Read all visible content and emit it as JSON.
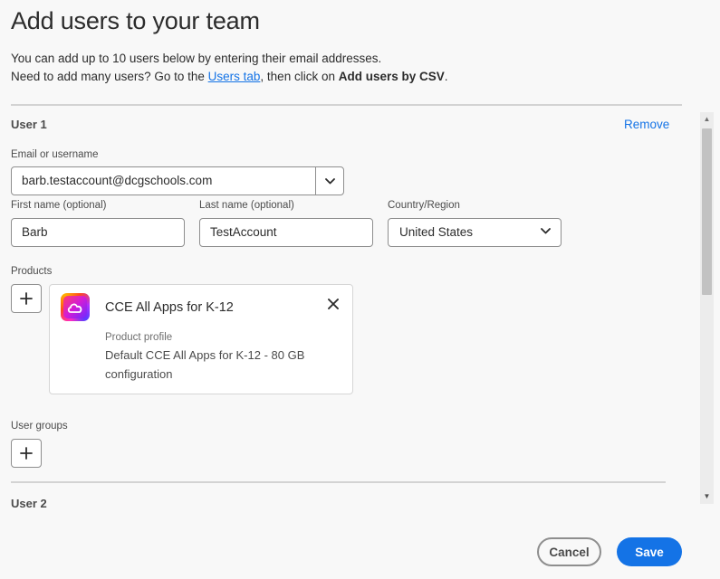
{
  "dialog": {
    "title": "Add users to your team",
    "intro_line1": "You can add up to 10 users below by entering their email addresses.",
    "intro_line2_pre": "Need to add many users? Go to the ",
    "intro_link": "Users tab",
    "intro_line2_mid": ", then click on ",
    "intro_bold": "Add users by CSV",
    "intro_line2_end": "."
  },
  "user1": {
    "heading": "User 1",
    "remove_label": "Remove",
    "email_label": "Email or username",
    "email_value": "barb.testaccount@dcgschools.com",
    "first_name_label": "First name (optional)",
    "first_name_value": "Barb",
    "last_name_label": "Last name (optional)",
    "last_name_value": "TestAccount",
    "country_label": "Country/Region",
    "country_value": "United States",
    "products_label": "Products",
    "product": {
      "icon": "creative-cloud-icon",
      "name": "CCE All Apps for K-12",
      "profile_label": "Product profile",
      "profile_value": "Default CCE All Apps for K-12 - 80 GB configuration"
    },
    "user_groups_label": "User groups"
  },
  "user2": {
    "heading": "User 2"
  },
  "footer": {
    "cancel_label": "Cancel",
    "save_label": "Save"
  },
  "colors": {
    "accent": "#1473e6",
    "background": "#f8f8f8",
    "border": "#8e8e8e"
  }
}
